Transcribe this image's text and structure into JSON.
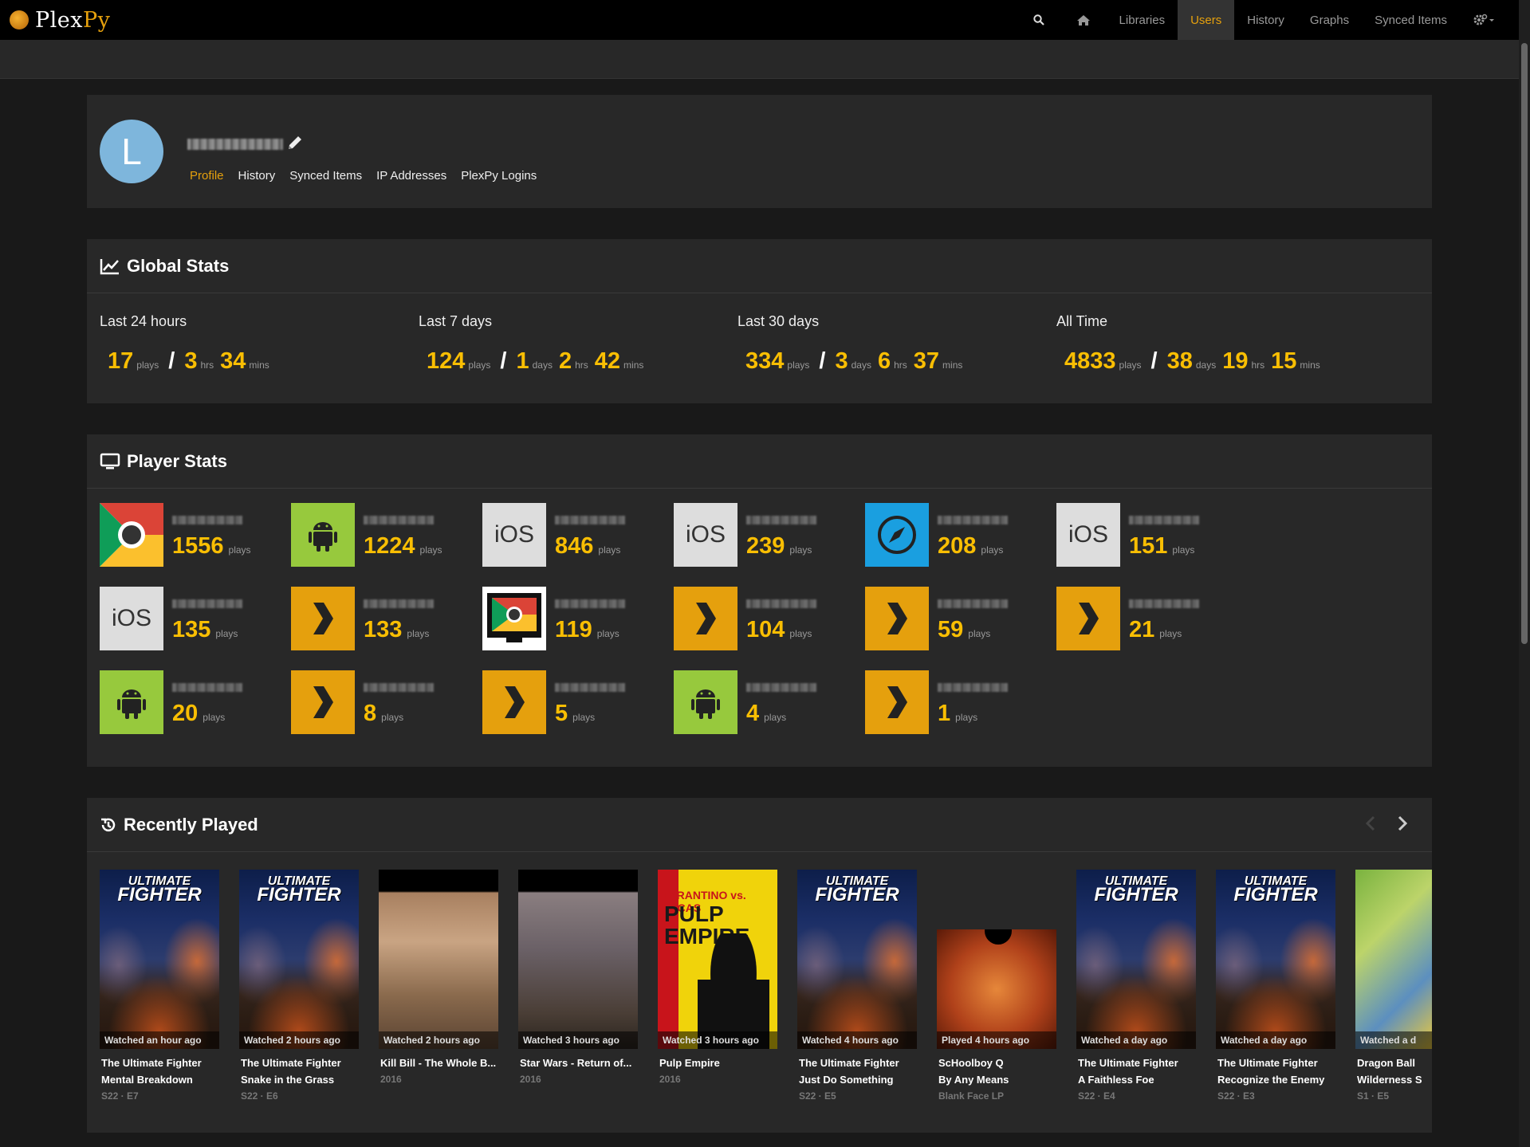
{
  "brand": {
    "name_a": "Plex",
    "name_b": "Py"
  },
  "nav": {
    "items": [
      {
        "label": "Libraries"
      },
      {
        "label": "Users",
        "active": true
      },
      {
        "label": "History"
      },
      {
        "label": "Graphs"
      },
      {
        "label": "Synced Items"
      }
    ]
  },
  "user": {
    "avatar_letter": "L",
    "tabs": [
      "Profile",
      "History",
      "Synced Items",
      "IP Addresses",
      "PlexPy Logins"
    ]
  },
  "global_stats": {
    "title": "Global Stats",
    "periods": [
      {
        "label": "Last 24 hours",
        "plays": "17",
        "days": null,
        "hrs": "3",
        "mins": "34"
      },
      {
        "label": "Last 7 days",
        "plays": "124",
        "days": "1",
        "hrs": "2",
        "mins": "42"
      },
      {
        "label": "Last 30 days",
        "plays": "334",
        "days": "3",
        "hrs": "6",
        "mins": "37"
      },
      {
        "label": "All Time",
        "plays": "4833",
        "days": "38",
        "hrs": "19",
        "mins": "15"
      }
    ],
    "units": {
      "plays": "plays",
      "days": "days",
      "hrs": "hrs",
      "mins": "mins"
    }
  },
  "player_stats": {
    "title": "Player Stats",
    "players": [
      {
        "type": "chrome",
        "plays": "1556"
      },
      {
        "type": "android",
        "plays": "1224"
      },
      {
        "type": "ios",
        "plays": "846"
      },
      {
        "type": "ios",
        "plays": "239"
      },
      {
        "type": "safari",
        "plays": "208"
      },
      {
        "type": "ios",
        "plays": "151"
      },
      {
        "type": "ios",
        "plays": "135"
      },
      {
        "type": "plex",
        "plays": "133"
      },
      {
        "type": "chromecast",
        "plays": "119"
      },
      {
        "type": "plex",
        "plays": "104"
      },
      {
        "type": "plex",
        "plays": "59"
      },
      {
        "type": "plex",
        "plays": "21"
      },
      {
        "type": "android",
        "plays": "20"
      },
      {
        "type": "plex",
        "plays": "8"
      },
      {
        "type": "plex",
        "plays": "5"
      },
      {
        "type": "android",
        "plays": "4"
      },
      {
        "type": "plex",
        "plays": "1"
      }
    ],
    "ios_label": "iOS",
    "plays_label": "plays"
  },
  "recently_played": {
    "title": "Recently Played",
    "items": [
      {
        "poster": "ufc",
        "watched": "Watched an hour ago",
        "title": "The Ultimate Fighter",
        "subtitle": "Mental Breakdown",
        "meta": "S22 · E7"
      },
      {
        "poster": "ufc",
        "watched": "Watched 2 hours ago",
        "title": "The Ultimate Fighter",
        "subtitle": "Snake in the Grass",
        "meta": "S22 · E6"
      },
      {
        "poster": "killbill",
        "watched": "Watched 2 hours ago",
        "title": "Kill Bill - The Whole B...",
        "subtitle": "",
        "meta": "2016"
      },
      {
        "poster": "starwars",
        "watched": "Watched 3 hours ago",
        "title": "Star Wars - Return of...",
        "subtitle": "",
        "meta": "2016"
      },
      {
        "poster": "pulp",
        "watched": "Watched 3 hours ago",
        "title": "Pulp Empire",
        "subtitle": "",
        "meta": "2016"
      },
      {
        "poster": "ufc",
        "watched": "Watched 4 hours ago",
        "title": "The Ultimate Fighter",
        "subtitle": "Just Do Something",
        "meta": "S22 · E5"
      },
      {
        "poster": "schoolboy",
        "watched": "Played 4 hours ago",
        "title": "ScHoolboy Q",
        "subtitle": "By Any Means",
        "meta": "Blank Face LP"
      },
      {
        "poster": "ufc",
        "watched": "Watched a day ago",
        "title": "The Ultimate Fighter",
        "subtitle": "A Faithless Foe",
        "meta": "S22 · E4"
      },
      {
        "poster": "ufc",
        "watched": "Watched a day ago",
        "title": "The Ultimate Fighter",
        "subtitle": "Recognize the Enemy",
        "meta": "S22 · E3"
      },
      {
        "poster": "dbz",
        "watched": "Watched a d",
        "title": "Dragon Ball",
        "subtitle": "Wilderness S",
        "meta": "S1 · E5"
      }
    ],
    "poster_text": {
      "ufc_line1": "ULTIMATE",
      "ufc_line2": "FIGHTER",
      "pulp_line1": "TARANTINO vs. LUCAS",
      "pulp_line2": "PULP",
      "pulp_line3": "EMPIRE"
    }
  },
  "colors": {
    "accent": "#e5a00d",
    "stat": "#f9be03",
    "android": "#97c93d",
    "plex": "#e5a00d",
    "ios": "#dddddd",
    "safari": "#1a9fe0"
  }
}
